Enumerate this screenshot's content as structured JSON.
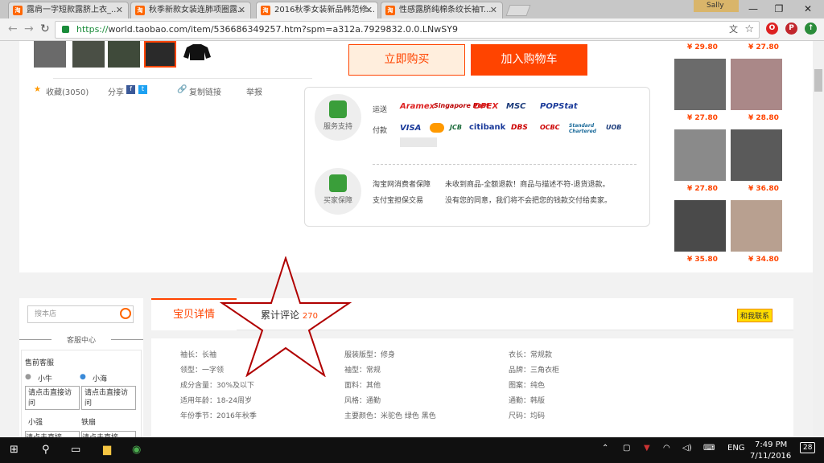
{
  "browser": {
    "tabs": [
      {
        "label": "露肩一字短款露脐上衣_..."
      },
      {
        "label": "秋季新款女装连肺项圈露..."
      },
      {
        "label": "2016秋季女装新品韩范修..."
      },
      {
        "label": "性感露脐纯棉条纹长袖T..."
      }
    ],
    "user": "Sally",
    "address": {
      "scheme": "https://",
      "rest": "world.taobao.com/item/536686349257.htm?spm=a312a.7929832.0.0.LNwSY9"
    }
  },
  "product": {
    "favorite": "收藏(3050)",
    "share": "分享",
    "copy_link": "复制链接",
    "report": "举报",
    "buy_now": "立即购买",
    "add_to_cart": "加入购物车"
  },
  "services": {
    "support_label": "服务支持",
    "buyer_label": "买家保障",
    "shipping_label": "运送",
    "payment_label": "付款",
    "shipping_logos": [
      "Aramex",
      "Singapore Post",
      "DPEX",
      "MSC",
      "POPStat"
    ],
    "payment_logos": [
      "VISA",
      "JCB",
      "citibank",
      "DBS",
      "OCBC",
      "Standard Chartered",
      "UOB"
    ],
    "guarantees": [
      {
        "name": "淘宝网消费者保障",
        "desc": "未收到商品-全额退款！商品与描述不符-退货退款。"
      },
      {
        "name": "支付宝担保交易",
        "desc": "没有您的同意，我们将不会把您的钱款交付给卖家。"
      }
    ]
  },
  "recommendations": {
    "prices": [
      "¥ 29.80",
      "¥ 27.80",
      "¥ 27.80",
      "¥ 28.80",
      "¥ 27.80",
      "¥ 36.80",
      "¥ 35.80",
      "¥ 34.80"
    ]
  },
  "shop_sidebar": {
    "search_placeholder": "搜本店",
    "service_title": "客服中心",
    "presale": "售前客服",
    "agents": [
      "小牛",
      "小海",
      "小强",
      "铁扇"
    ],
    "chat_button": "请点击直接访问",
    "chat_button_cut": "请点击直接"
  },
  "detail_tabs": {
    "details": "宝贝详情",
    "reviews": "累计评论",
    "review_count": "270",
    "contact": "和我联系"
  },
  "attributes": [
    [
      "袖长：长袖",
      "服装版型：修身",
      "衣长：常规款"
    ],
    [
      "领型：一字领",
      "袖型：常规",
      "品牌：三角衣柜"
    ],
    [
      "成分含量：30%及以下",
      "面料：其他",
      "图案：纯色"
    ],
    [
      "适用年龄：18-24周岁",
      "风格：通勤",
      "通勤：韩版"
    ],
    [
      "年份季节：2016年秋季",
      "主要颜色：米驼色 绿色 黑色",
      "尺码：均码"
    ]
  ],
  "taskbar": {
    "lang": "ENG",
    "time": "7:49 PM",
    "date": "7/11/2016",
    "notifications": "28"
  },
  "colors": {
    "accent": "#ff4400",
    "annotation": "#b00000"
  }
}
